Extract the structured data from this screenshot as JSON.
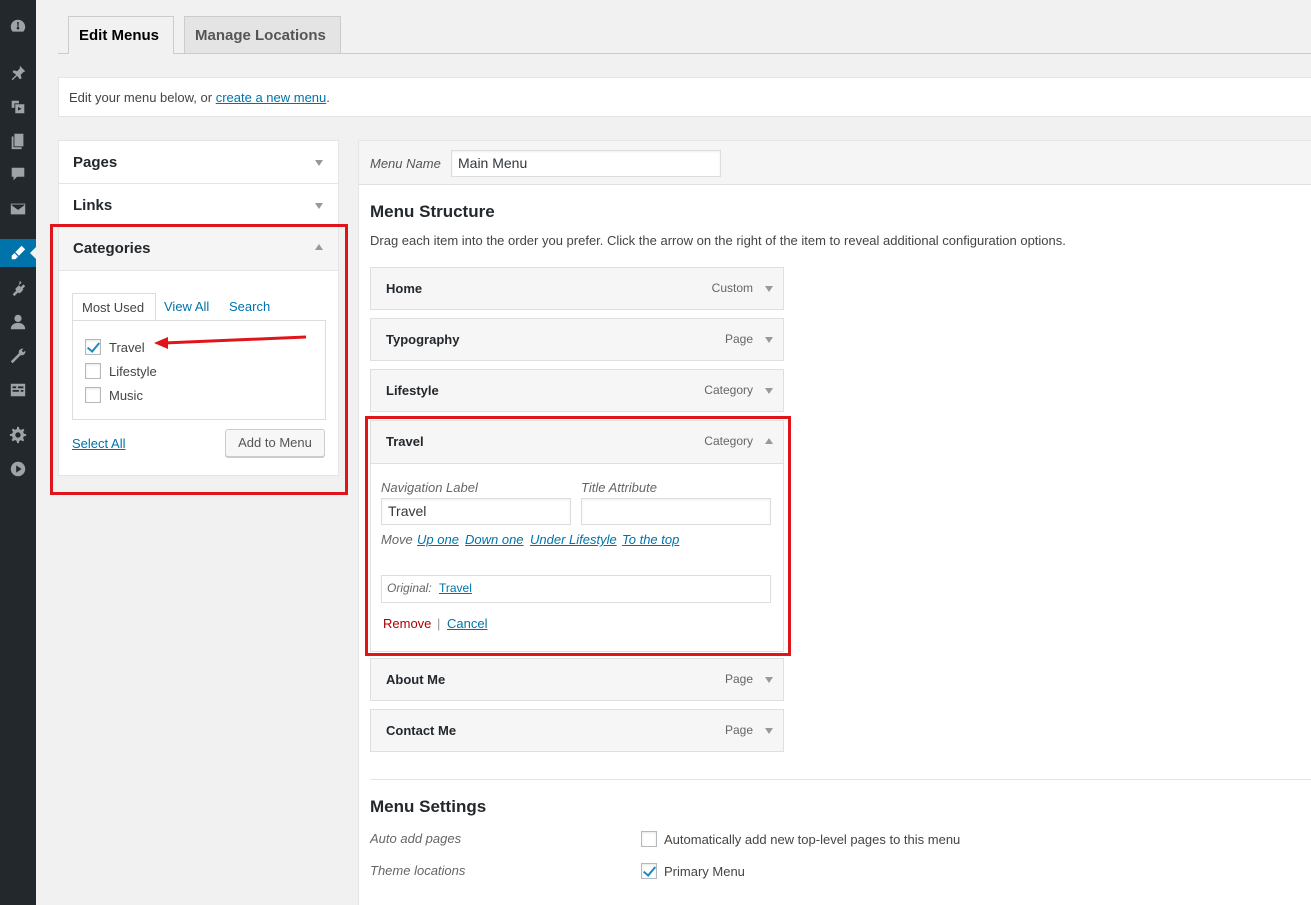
{
  "sidebar": {
    "icons": [
      "dashboard-icon",
      "pin-icon",
      "media-icon",
      "pages-icon",
      "comments-icon",
      "mail-icon",
      "appearance-icon",
      "plugins-icon",
      "users-icon",
      "tools-icon",
      "settings-alt-icon",
      "settings-icon",
      "play-icon"
    ]
  },
  "tabs": {
    "edit_menus": "Edit Menus",
    "manage_locations": "Manage Locations"
  },
  "notice": {
    "text": "Edit your menu below, or ",
    "link": "create a new menu",
    "suffix": "."
  },
  "accordion": {
    "pages": "Pages",
    "links": "Links",
    "categories": "Categories",
    "cat_tabs": {
      "most_used": "Most Used",
      "view_all": "View All",
      "search": "Search"
    },
    "items": [
      {
        "label": "Travel",
        "checked": true
      },
      {
        "label": "Lifestyle",
        "checked": false
      },
      {
        "label": "Music",
        "checked": false
      }
    ],
    "select_all": "Select All",
    "add_to_menu": "Add to Menu"
  },
  "menu": {
    "name_label": "Menu Name",
    "name_value": "Main Menu",
    "structure_title": "Menu Structure",
    "structure_desc": "Drag each item into the order you prefer. Click the arrow on the right of the item to reveal additional configuration options.",
    "items": [
      {
        "title": "Home",
        "type": "Custom"
      },
      {
        "title": "Typography",
        "type": "Page"
      },
      {
        "title": "Lifestyle",
        "type": "Category"
      },
      {
        "title": "Travel",
        "type": "Category"
      },
      {
        "title": "About Me",
        "type": "Page"
      },
      {
        "title": "Contact Me",
        "type": "Page"
      }
    ],
    "open_item": {
      "nav_label_title": "Navigation Label",
      "nav_label_value": "Travel",
      "title_attr_title": "Title Attribute",
      "title_attr_value": "",
      "move_label": "Move",
      "move_up": "Up one",
      "move_down": "Down one",
      "move_under": "Under Lifestyle",
      "move_top": "To the top",
      "original_label": "Original:",
      "original_link": "Travel",
      "remove": "Remove",
      "separator": "|",
      "cancel": "Cancel"
    },
    "settings": {
      "title": "Menu Settings",
      "auto_add_label": "Auto add pages",
      "auto_add_text": "Automatically add new top-level pages to this menu",
      "auto_add_checked": false,
      "theme_locations_label": "Theme locations",
      "primary_menu_text": "Primary Menu",
      "primary_menu_checked": true
    }
  },
  "colors": {
    "accent": "#0073aa",
    "annotation": "#e0151a",
    "remove": "#a00"
  }
}
